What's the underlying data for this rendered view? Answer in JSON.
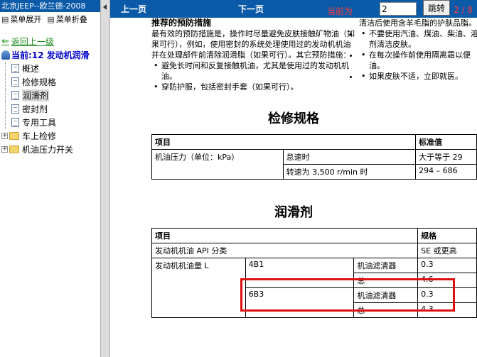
{
  "left": {
    "title": "北京JEEP--欧兰德-2008",
    "menu_expand": "菜单展开",
    "menu_collapse": "菜单折叠",
    "back_link": "返回上一级",
    "current": "当前:12 发动机润滑",
    "items": [
      {
        "label": "概述"
      },
      {
        "label": "检修规格"
      },
      {
        "label": "润滑剂"
      },
      {
        "label": "密封剂"
      },
      {
        "label": "专用工具"
      }
    ],
    "folders": [
      {
        "label": "车上检修"
      },
      {
        "label": "机油压力开关"
      }
    ]
  },
  "nav": {
    "prev": "上一页",
    "next": "下一页",
    "current_label": "当前为",
    "page_value": "2",
    "goto": "跳转",
    "page_count": "2 / 8"
  },
  "doc": {
    "precaution_title": "推荐的预防措施",
    "precaution_text": "最有效的预防措施是，操作时尽量避免皮肤接触矿物油（如果可行），例如，使用密封的系统处理使用过的发动机机油并在处理部件前清除润滑脂（如果可行）。其它预防措施：",
    "bullets_left": [
      "避免长时间和反复接触机油，尤其是使用过的发动机机油。",
      "穿防护服，包括密封手套（如果可行）。"
    ],
    "right_top": "清洁后使用含羊毛脂的护肤品脂。",
    "bullets_right": [
      "不要使用汽油、煤油、柴油、溶剂清洁皮肤。",
      "在每次操作前使用隔离霜以便油。",
      "如果皮肤不适，立即就医。"
    ],
    "spec_title": "检修规格",
    "spec_table": {
      "h_item": "项目",
      "h_std": "标准值",
      "row_label": "机油压力（单位：kPa）",
      "r1_cond": "怠速时",
      "r1_val": "大于等于 29",
      "r2_cond": "转速为 3,500 r/min 时",
      "r2_val": "294 – 686"
    },
    "lube_title": "润滑剂",
    "lube_table": {
      "h_item": "项目",
      "h_spec": "规格",
      "api_label": "发动机机油 API 分类",
      "api_val": "SE 或更高",
      "qty_label": "发动机机油量 L",
      "e1": "4B1",
      "e1_filter": "机油滤清器",
      "e1_filter_val": "0.3",
      "e1_total": "总",
      "e1_total_val": "4.6",
      "e2": "6B3",
      "e2_filter": "机油滤清器",
      "e2_filter_val": "0.3",
      "e2_total": "总",
      "e2_total_val": "4.3"
    }
  },
  "colors": {
    "nav_bg": "#0a5aa8",
    "highlight_box": "#e01010",
    "page_label": "#ff3b3b"
  }
}
